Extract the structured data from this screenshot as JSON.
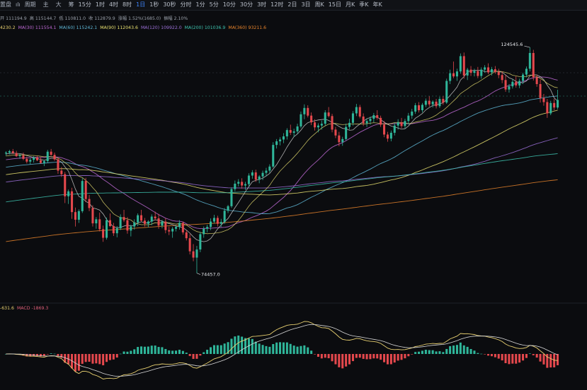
{
  "toolbar": {
    "left_labels": [
      "置盘",
      "ılı",
      "周期"
    ],
    "tool_buttons": [
      "主",
      "大",
      "筹"
    ],
    "timeframes": [
      "15分",
      "1时",
      "4时",
      "8时",
      "1日",
      "1秒",
      "30秒",
      "分时",
      "1分",
      "5分",
      "10分",
      "30分",
      "3时",
      "12时",
      "2日",
      "3日",
      "周K",
      "15日",
      "月K",
      "季K",
      "年K"
    ],
    "active_timeframe": "1日"
  },
  "legend_top": {
    "items": [
      {
        "text": "开 111194.9",
        "color": "#9aa0aa"
      },
      {
        "text": "高 115144.7",
        "color": "#9aa0aa"
      },
      {
        "text": "低 110811.0",
        "color": "#9aa0aa"
      },
      {
        "text": "收 112879.9",
        "color": "#9aa0aa"
      },
      {
        "text": "涨幅 1.52%(1685.0)",
        "color": "#9aa0aa"
      },
      {
        "text": "振幅 2.10%",
        "color": "#9aa0aa"
      }
    ]
  },
  "legend_ma": {
    "items": [
      {
        "text": "4230.2",
        "color": "#e8d070"
      },
      {
        "text": "MA(30) 111554.1",
        "color": "#c06ad6"
      },
      {
        "text": "MA(60) 115242.1",
        "color": "#5fb7d6"
      },
      {
        "text": "MA(90) 112043.6",
        "color": "#e8e070"
      },
      {
        "text": "MA(120) 109922.0",
        "color": "#9c70d8"
      },
      {
        "text": "MA(200) 101036.9",
        "color": "#3ec4b0"
      },
      {
        "text": "MA(360) 93211.6",
        "color": "#e8842c"
      }
    ]
  },
  "legend_macd": {
    "items": [
      {
        "text": "-631.6",
        "color": "#e8d070"
      },
      {
        "text": "MACD -1869.3",
        "color": "#e0607a"
      }
    ]
  },
  "chart_data": {
    "type": "candlestick",
    "y_range": [
      70000,
      128000
    ],
    "high_label": "124545.6",
    "low_label": "74457.0",
    "colors": {
      "up": "#2fb69a",
      "down": "#e5484d",
      "bg": "#0b0c0f"
    },
    "candles": [
      [
        101000,
        101500,
        100500,
        101200
      ],
      [
        101200,
        101800,
        100800,
        101500
      ],
      [
        101500,
        102000,
        100900,
        101100
      ],
      [
        101100,
        101600,
        100200,
        100400
      ],
      [
        100400,
        101000,
        99800,
        100600
      ],
      [
        100600,
        101200,
        99500,
        99800
      ],
      [
        99800,
        100300,
        98800,
        99200
      ],
      [
        99200,
        100000,
        98600,
        99600
      ],
      [
        99600,
        100400,
        99000,
        100100
      ],
      [
        100100,
        100500,
        99300,
        99500
      ],
      [
        99500,
        100200,
        98700,
        98900
      ],
      [
        98900,
        99600,
        98200,
        99300
      ],
      [
        99300,
        101800,
        99000,
        101400
      ],
      [
        101400,
        102000,
        100500,
        100700
      ],
      [
        100700,
        101200,
        99400,
        99700
      ],
      [
        99700,
        100100,
        96500,
        97200
      ],
      [
        97200,
        98000,
        95800,
        96400
      ],
      [
        96400,
        96900,
        90000,
        91500
      ],
      [
        91500,
        93000,
        89800,
        92600
      ],
      [
        92600,
        93400,
        86500,
        88000
      ],
      [
        88000,
        89000,
        84800,
        86300
      ],
      [
        86300,
        88600,
        85600,
        88200
      ],
      [
        88200,
        95500,
        87800,
        94900
      ],
      [
        94900,
        95600,
        90200,
        90900
      ],
      [
        90900,
        91800,
        88200,
        88900
      ],
      [
        88900,
        89500,
        84800,
        85500
      ],
      [
        85500,
        86900,
        84300,
        86400
      ],
      [
        86400,
        87900,
        83700,
        84200
      ],
      [
        84200,
        85000,
        81400,
        82300
      ],
      [
        82300,
        86800,
        81900,
        86200
      ],
      [
        86200,
        87700,
        84700,
        84900
      ],
      [
        84900,
        85600,
        82700,
        83300
      ],
      [
        83300,
        84900,
        82400,
        84400
      ],
      [
        84400,
        87500,
        84000,
        86900
      ],
      [
        86900,
        88500,
        85800,
        86200
      ],
      [
        86200,
        86900,
        83200,
        83900
      ],
      [
        83900,
        85200,
        82600,
        84800
      ],
      [
        84800,
        86400,
        84100,
        85700
      ],
      [
        85700,
        87700,
        84900,
        87300
      ],
      [
        87300,
        88500,
        85900,
        86100
      ],
      [
        86100,
        86700,
        84800,
        85400
      ],
      [
        85400,
        86200,
        84600,
        85900
      ],
      [
        85900,
        87500,
        85100,
        87000
      ],
      [
        87000,
        88100,
        86200,
        86600
      ],
      [
        86600,
        87600,
        84300,
        85000
      ],
      [
        85000,
        86300,
        84400,
        85900
      ],
      [
        85900,
        86600,
        83300,
        84000
      ],
      [
        84000,
        84800,
        82900,
        83700
      ],
      [
        83700,
        84700,
        82300,
        84300
      ],
      [
        84300,
        85100,
        83700,
        84700
      ],
      [
        84700,
        86200,
        84100,
        85600
      ],
      [
        85600,
        85900,
        83000,
        83500
      ],
      [
        83500,
        84000,
        81700,
        82200
      ],
      [
        82200,
        83100,
        78600,
        79300
      ],
      [
        79300,
        80900,
        77100,
        77900
      ],
      [
        77900,
        80500,
        74457,
        79700
      ],
      [
        79700,
        83600,
        79100,
        83100
      ],
      [
        83100,
        84800,
        82300,
        84300
      ],
      [
        84300,
        85200,
        83500,
        84700
      ],
      [
        84700,
        86600,
        84000,
        85900
      ],
      [
        85900,
        87400,
        85500,
        86700
      ],
      [
        86700,
        87200,
        84800,
        85400
      ],
      [
        85400,
        86500,
        84700,
        85800
      ],
      [
        85800,
        88900,
        85400,
        88300
      ],
      [
        88300,
        89600,
        87800,
        89300
      ],
      [
        89300,
        93500,
        88900,
        93100
      ],
      [
        93100,
        95000,
        92600,
        94300
      ],
      [
        94300,
        95300,
        93700,
        94700
      ],
      [
        94700,
        95500,
        93200,
        93900
      ],
      [
        93900,
        94700,
        92900,
        94200
      ],
      [
        94200,
        96600,
        93600,
        96100
      ],
      [
        96100,
        97300,
        95400,
        96800
      ],
      [
        96800,
        97400,
        94700,
        95200
      ],
      [
        95200,
        96200,
        94400,
        95900
      ],
      [
        95900,
        97200,
        95100,
        96700
      ],
      [
        96700,
        97800,
        95900,
        97200
      ],
      [
        97200,
        98600,
        96700,
        98100
      ],
      [
        98100,
        103500,
        97800,
        102900
      ],
      [
        102900,
        104200,
        102100,
        103700
      ],
      [
        103700,
        104600,
        102800,
        104100
      ],
      [
        104100,
        105500,
        103300,
        104800
      ],
      [
        104800,
        106600,
        104100,
        106200
      ],
      [
        106200,
        107400,
        105100,
        105600
      ],
      [
        105600,
        106500,
        104700,
        105900
      ],
      [
        105900,
        107600,
        105300,
        107000
      ],
      [
        107000,
        110300,
        106600,
        109700
      ],
      [
        109700,
        111900,
        108600,
        111100
      ],
      [
        111100,
        111700,
        109000,
        109400
      ],
      [
        109400,
        110100,
        107300,
        107900
      ],
      [
        107900,
        108600,
        106100,
        106800
      ],
      [
        106800,
        107700,
        105700,
        107200
      ],
      [
        107200,
        108300,
        106300,
        107600
      ],
      [
        107600,
        110600,
        107200,
        110100
      ],
      [
        110100,
        111300,
        109000,
        109300
      ],
      [
        109300,
        109800,
        105700,
        106300
      ],
      [
        106300,
        106900,
        104400,
        105000
      ],
      [
        105000,
        105800,
        102600,
        103500
      ],
      [
        103500,
        104700,
        102700,
        104200
      ],
      [
        104200,
        107600,
        103900,
        106900
      ],
      [
        106900,
        108700,
        106300,
        107800
      ],
      [
        107800,
        110400,
        107200,
        109900
      ],
      [
        109900,
        112000,
        109300,
        111300
      ],
      [
        111300,
        111800,
        108800,
        109200
      ],
      [
        109200,
        109900,
        107100,
        107700
      ],
      [
        107700,
        108800,
        106900,
        108200
      ],
      [
        108200,
        109200,
        107400,
        108700
      ],
      [
        108700,
        110000,
        107900,
        109500
      ],
      [
        109500,
        110600,
        108500,
        108900
      ],
      [
        108900,
        109400,
        106900,
        107400
      ],
      [
        107400,
        108200,
        104600,
        105200
      ],
      [
        105200,
        105800,
        103600,
        104300
      ],
      [
        104300,
        106100,
        103700,
        105600
      ],
      [
        105600,
        107800,
        105000,
        107200
      ],
      [
        107200,
        108600,
        106300,
        107900
      ],
      [
        107900,
        108900,
        106600,
        107100
      ],
      [
        107100,
        108700,
        106500,
        108200
      ],
      [
        108200,
        110000,
        107400,
        109400
      ],
      [
        109400,
        110900,
        108700,
        110300
      ],
      [
        110300,
        112200,
        109800,
        111700
      ],
      [
        111700,
        112400,
        110100,
        110600
      ],
      [
        110600,
        112200,
        110100,
        111800
      ],
      [
        111800,
        113200,
        111300,
        112700
      ],
      [
        112700,
        113700,
        111400,
        111900
      ],
      [
        111900,
        112800,
        111200,
        112500
      ],
      [
        112500,
        113100,
        111000,
        111500
      ],
      [
        111500,
        113600,
        111100,
        113100
      ],
      [
        113100,
        113700,
        111800,
        112300
      ],
      [
        112300,
        117600,
        112000,
        117100
      ],
      [
        117100,
        119600,
        116400,
        118800
      ],
      [
        118800,
        121400,
        117700,
        118100
      ],
      [
        118100,
        119800,
        117100,
        119200
      ],
      [
        119200,
        123200,
        118700,
        122600
      ],
      [
        122600,
        123400,
        117600,
        118300
      ],
      [
        118300,
        120000,
        117300,
        119600
      ],
      [
        119600,
        120400,
        118200,
        118900
      ],
      [
        118900,
        119800,
        118100,
        119300
      ],
      [
        119300,
        120200,
        117700,
        118200
      ],
      [
        118200,
        120100,
        117600,
        119600
      ],
      [
        119600,
        120600,
        118900,
        120100
      ],
      [
        120100,
        121000,
        118600,
        119000
      ],
      [
        119000,
        120200,
        118300,
        119700
      ],
      [
        119700,
        120400,
        118700,
        119100
      ],
      [
        119100,
        119800,
        117700,
        118400
      ],
      [
        118400,
        119200,
        116600,
        117300
      ],
      [
        117300,
        118400,
        114700,
        115200
      ],
      [
        115200,
        116400,
        114500,
        115900
      ],
      [
        115900,
        117500,
        115400,
        116900
      ],
      [
        116900,
        118100,
        115600,
        116100
      ],
      [
        116100,
        117600,
        115500,
        117100
      ],
      [
        117100,
        118900,
        116400,
        118500
      ],
      [
        118500,
        120300,
        117900,
        119800
      ],
      [
        119800,
        124545.6,
        119200,
        123300
      ],
      [
        123300,
        124000,
        117200,
        117900
      ],
      [
        117900,
        118500,
        115800,
        116400
      ],
      [
        116400,
        117400,
        112300,
        113300
      ],
      [
        113300,
        114200,
        111600,
        112400
      ],
      [
        112400,
        113100,
        108900,
        109900
      ],
      [
        109900,
        112700,
        109500,
        112200
      ],
      [
        112200,
        113100,
        110600,
        111200
      ],
      [
        111200,
        115144.7,
        110811,
        112879.9
      ]
    ],
    "moving_averages": [
      {
        "name": "MA(30)",
        "period": 30,
        "color": "#c06ad6"
      },
      {
        "name": "MA(60)",
        "period": 60,
        "color": "#5fb7d6"
      },
      {
        "name": "MA(90)",
        "period": 90,
        "color": "#e8e070"
      },
      {
        "name": "MA(120)",
        "period": 120,
        "color": "#9c70d8"
      },
      {
        "name": "MA(200)",
        "period": 200,
        "color": "#3ec4b0"
      },
      {
        "name": "MA(360)",
        "period": 360,
        "color": "#e8842c"
      }
    ],
    "macd": {
      "dif_label": "-631.6",
      "macd_label": "MACD -1869.3"
    }
  }
}
